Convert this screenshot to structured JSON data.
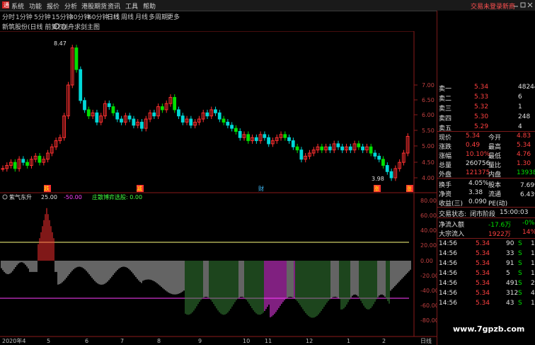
{
  "menu": {
    "items": [
      "系统",
      "功能",
      "报价",
      "分析",
      "港股期货",
      "资讯",
      "工具",
      "帮助"
    ],
    "trade_status": "交易未登录",
    "right_cut": "新商"
  },
  "periods": [
    "分时",
    "1分钟",
    "5分钟",
    "15分钟",
    "30分钟",
    "60分钟",
    "日线",
    "周线",
    "月线",
    "多周期",
    "更多"
  ],
  "chart": {
    "title": "新筑股份(日线 前复权)",
    "indicator": "剑舟求剑主图",
    "high_label": "8.47",
    "low_label": "3.98",
    "price_axis": [
      "7.00",
      "6.50",
      "6.00",
      "5.50",
      "5.00",
      "4.50",
      "4.00"
    ],
    "markers": [
      "跌",
      "减",
      "财",
      "涨",
      "涨"
    ],
    "sub_title": "紫气东升",
    "sub_values": [
      "25.00",
      "-50.00"
    ],
    "sub_extra": "庄散博弈选股: 0.00",
    "sub_axis": [
      "80.00",
      "60.00",
      "40.00",
      "20.00",
      "0.00",
      "-20.00",
      "-40.00",
      "-60.00",
      "-80.00"
    ],
    "x_labels": [
      "2020年4",
      "5",
      "6",
      "7",
      "8",
      "9",
      "10",
      "11",
      "12",
      "1",
      "2"
    ],
    "x_unit": "日线"
  },
  "order_book": {
    "asks": [
      {
        "label": "卖一",
        "price": "5.34",
        "vol": "48244"
      },
      {
        "label": "卖二",
        "price": "5.33",
        "vol": "6"
      },
      {
        "label": "卖三",
        "price": "5.32",
        "vol": "1"
      },
      {
        "label": "卖四",
        "price": "5.30",
        "vol": "248"
      },
      {
        "label": "卖五",
        "price": "5.29",
        "vol": "4"
      }
    ]
  },
  "quote": {
    "rows": [
      {
        "l1": "现价",
        "v1": "5.34",
        "l2": "今开",
        "v2": "4.83"
      },
      {
        "l1": "涨跌",
        "v1": "0.49",
        "l2": "最高",
        "v2": "5.34"
      },
      {
        "l1": "涨幅",
        "v1": "10.10%",
        "l2": "最低",
        "v2": "4.76"
      },
      {
        "l1": "总量",
        "v1": "260756",
        "l2": "量比",
        "v2": "1.30"
      },
      {
        "l1": "外盘",
        "v1": "121375",
        "l2": "内盘",
        "v2": "139381"
      }
    ],
    "rows2": [
      {
        "l1": "换手",
        "v1": "4.05%",
        "l2": "股本",
        "v2": "7.69亿"
      },
      {
        "l1": "净资",
        "v1": "3.38",
        "l2": "流通",
        "v2": "6.43亿"
      },
      {
        "l1": "收益(三)",
        "v1": "0.090",
        "l2": "PE(动)",
        "v2": ""
      }
    ]
  },
  "trade_state": {
    "label": "交易状态:",
    "value": "闭市阶段",
    "time": "15:00:03"
  },
  "flows": [
    {
      "label": "净流入额",
      "v1": "-17.6万",
      "v2": "-0%"
    },
    {
      "label": "大宗流入",
      "v1": "1922万",
      "v2": "14%"
    }
  ],
  "ticks": [
    {
      "t": "14:56",
      "p": "5.34",
      "v": "90",
      "s": "S",
      "n": "1"
    },
    {
      "t": "14:56",
      "p": "5.34",
      "v": "33",
      "s": "S",
      "n": "1"
    },
    {
      "t": "14:56",
      "p": "5.34",
      "v": "91",
      "s": "S",
      "n": "1"
    },
    {
      "t": "14:56",
      "p": "5.34",
      "v": "5",
      "s": "S",
      "n": "1"
    },
    {
      "t": "14:56",
      "p": "5.34",
      "v": "491",
      "s": "S",
      "n": "2"
    },
    {
      "t": "14:56",
      "p": "5.34",
      "v": "312",
      "s": "S",
      "n": "4"
    },
    {
      "t": "14:56",
      "p": "5.34",
      "v": "43",
      "s": "S",
      "n": "1"
    }
  ],
  "watermark": "www.7gpzb.com",
  "colors": {
    "up": "#ff3030",
    "down": "#00d8d8",
    "green": "#00e000",
    "magenta": "#ff40ff",
    "yellow": "#ffff80"
  }
}
